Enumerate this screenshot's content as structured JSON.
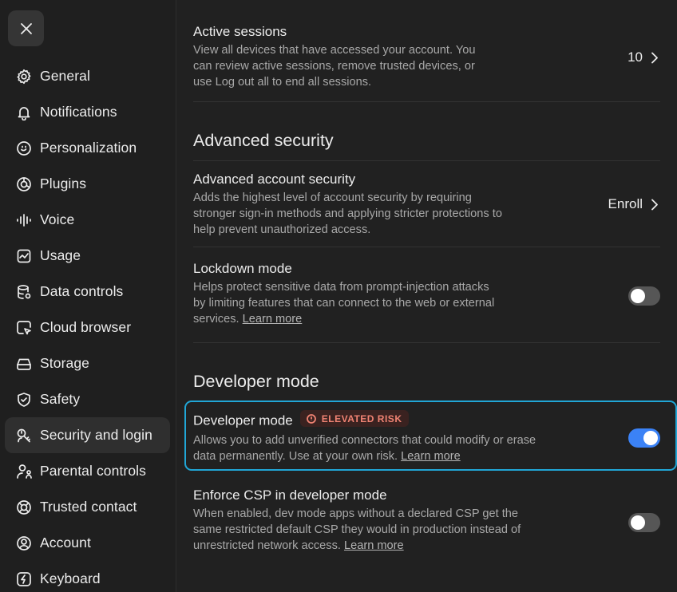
{
  "sidebar": {
    "items": [
      {
        "label": "General",
        "icon": "gear-icon"
      },
      {
        "label": "Notifications",
        "icon": "bell-icon"
      },
      {
        "label": "Personalization",
        "icon": "personalization-icon"
      },
      {
        "label": "Plugins",
        "icon": "plugins-icon"
      },
      {
        "label": "Voice",
        "icon": "voice-waveform-icon"
      },
      {
        "label": "Usage",
        "icon": "usage-chart-icon"
      },
      {
        "label": "Data controls",
        "icon": "database-icon"
      },
      {
        "label": "Cloud browser",
        "icon": "cloud-browser-icon"
      },
      {
        "label": "Storage",
        "icon": "storage-drive-icon"
      },
      {
        "label": "Safety",
        "icon": "shield-check-icon"
      },
      {
        "label": "Security and login",
        "icon": "security-key-icon"
      },
      {
        "label": "Parental controls",
        "icon": "parental-controls-icon"
      },
      {
        "label": "Trusted contact",
        "icon": "lifebuoy-icon"
      },
      {
        "label": "Account",
        "icon": "account-icon"
      },
      {
        "label": "Keyboard",
        "icon": "keyboard-bolt-icon"
      }
    ],
    "active": "Security and login"
  },
  "main": {
    "active_sessions": {
      "title": "Active sessions",
      "desc": "View all devices that have accessed your account. You can review active sessions, remove trusted devices, or use Log out all to end all sessions.",
      "value": "10"
    },
    "advanced_security": {
      "section_title": "Advanced security",
      "account_security": {
        "title": "Advanced account security",
        "desc": "Adds the highest level of account security by requiring stronger sign-in methods and applying stricter protections to help prevent unauthorized access.",
        "action": "Enroll"
      },
      "lockdown": {
        "title": "Lockdown mode",
        "desc": "Helps protect sensitive data from prompt-injection attacks by limiting features that can connect to the web or external services.",
        "link": "Learn more",
        "enabled": false
      }
    },
    "developer": {
      "section_title": "Developer mode",
      "dev_mode": {
        "title": "Developer mode",
        "badge": "ELEVATED RISK",
        "desc": "Allows you to add unverified connectors that could modify or erase data permanently. Use at your own risk.",
        "link": "Learn more",
        "enabled": true
      },
      "csp": {
        "title": "Enforce CSP in developer mode",
        "desc": "When enabled, dev mode apps without a declared CSP get the same restricted default CSP they would in production instead of unrestricted network access.",
        "link": "Learn more",
        "enabled": false
      }
    }
  },
  "colors": {
    "accent_toggle": "#3b82f6",
    "highlight_border": "#21a6d6",
    "badge_text": "#f08373"
  }
}
